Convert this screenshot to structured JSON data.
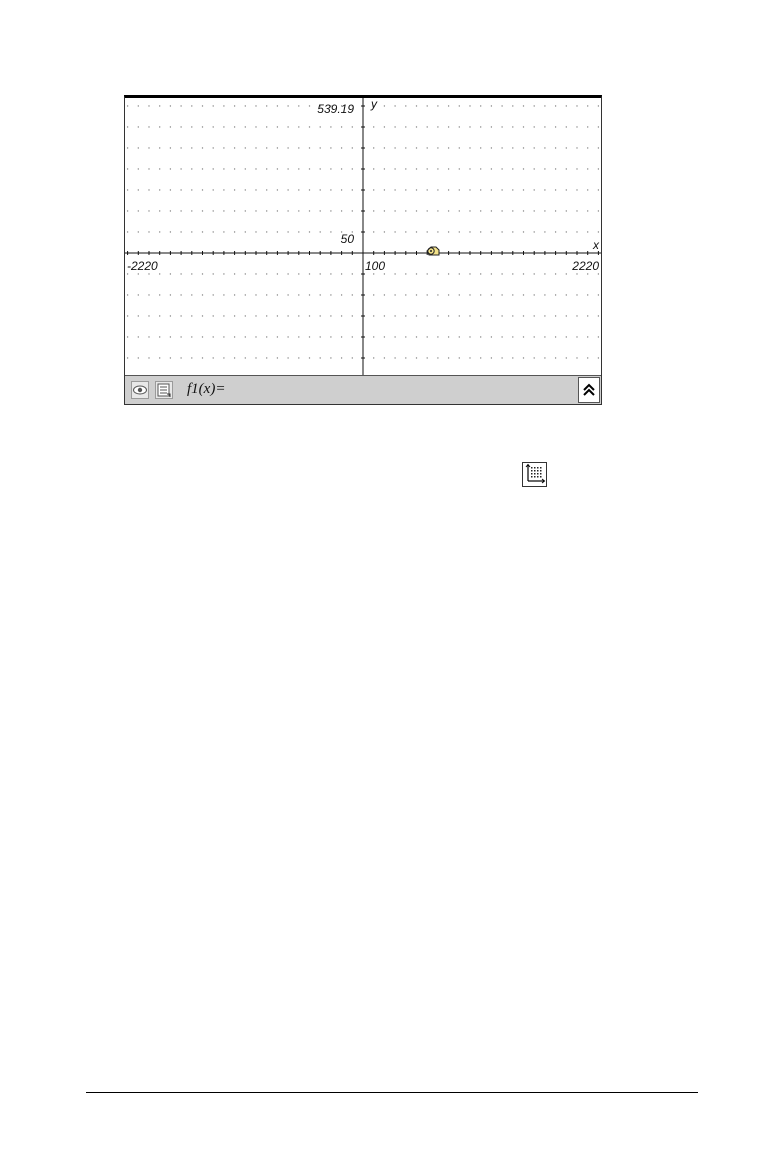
{
  "graph": {
    "x_axis_name": "x",
    "y_axis_name": "y",
    "x_min_label": "-2220",
    "x_max_label": "2220",
    "y_max_label": "539.19",
    "x_scale_label": "100",
    "y_scale_label": "50"
  },
  "entry_line": {
    "function_label": "f1(x)="
  },
  "icons": {
    "view": "eye-icon",
    "list": "list-icon",
    "expand": "double-chevron-up-icon",
    "window": "window-settings-icon"
  }
}
